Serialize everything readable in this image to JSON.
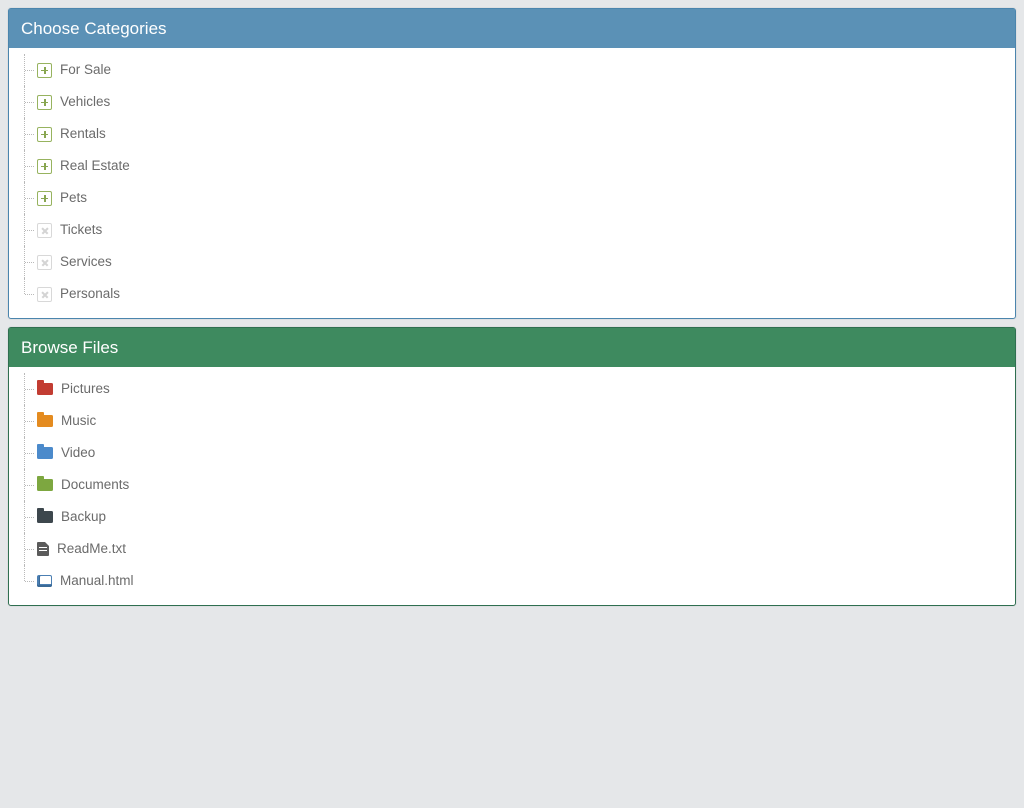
{
  "categories": {
    "title": "Choose Categories",
    "items": [
      {
        "label": "For Sale",
        "kind": "expand"
      },
      {
        "label": "Vehicles",
        "kind": "expand"
      },
      {
        "label": "Rentals",
        "kind": "expand"
      },
      {
        "label": "Real Estate",
        "kind": "expand"
      },
      {
        "label": "Pets",
        "kind": "expand"
      },
      {
        "label": "Tickets",
        "kind": "leaf"
      },
      {
        "label": "Services",
        "kind": "leaf"
      },
      {
        "label": "Personals",
        "kind": "leaf"
      }
    ]
  },
  "files": {
    "title": "Browse Files",
    "items": [
      {
        "label": "Pictures",
        "icon": "folder",
        "color": "red"
      },
      {
        "label": "Music",
        "icon": "folder",
        "color": "orange"
      },
      {
        "label": "Video",
        "icon": "folder",
        "color": "blue"
      },
      {
        "label": "Documents",
        "icon": "folder",
        "color": "green"
      },
      {
        "label": "Backup",
        "icon": "folder",
        "color": "dark"
      },
      {
        "label": "ReadMe.txt",
        "icon": "file-text"
      },
      {
        "label": "Manual.html",
        "icon": "book"
      }
    ]
  }
}
